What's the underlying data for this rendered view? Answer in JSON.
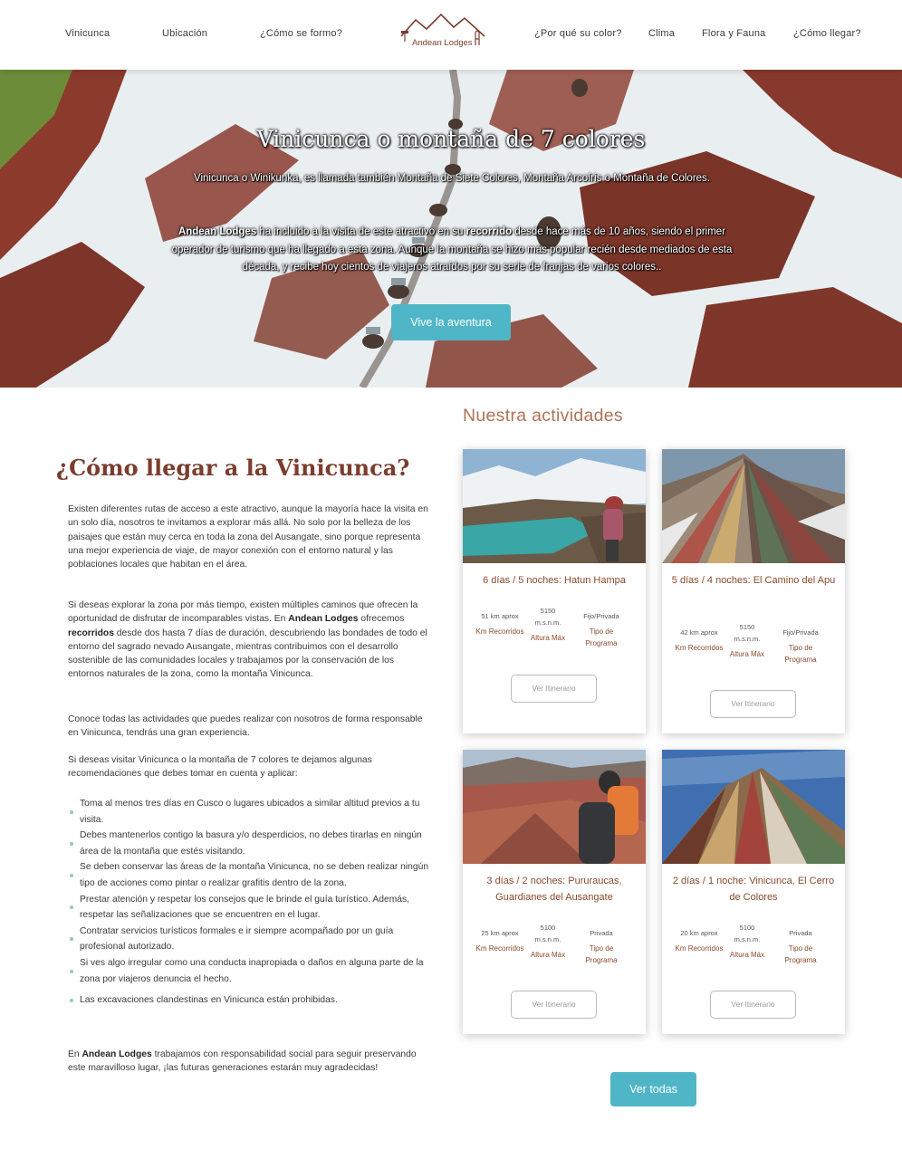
{
  "nav": {
    "left_items": [
      "Vinicunca",
      "Ubicación",
      "¿Cómo se formo?"
    ],
    "right_items": [
      "¿Por qué su color?",
      "Clima",
      "Flora y Fauna",
      "¿Cómo llegar?"
    ],
    "logo_text": "Andean Lodges"
  },
  "hero": {
    "title": "Vinicunca o montaña de 7 colores",
    "intro": "Vinicunca o Winikunka, es llamada también Montaña de Siete Colores, Montaña Arcoíris o Montaña de Colores.",
    "p2_brand": "Andean Lodges",
    "p2_a": " ha incluido a la visita de este atractivo en su ",
    "p2_bold": "recorrido",
    "p2_b": " desde hace más de 10 años, siendo el primer operador de turismo que ha llegado a esta zona. Aunque la montaña se hizo más popular recién desde mediados de esta década, y recibe hoy cientos de viajeros atraídos por su serie de franjas de varios colores..",
    "button": "Vive la aventura"
  },
  "howto": {
    "title": "¿Cómo llegar a la Vinicunca?",
    "p1": "Existen diferentes rutas de acceso a este atractivo, aunque la mayoría hace la visita en un solo día, nosotros te invitamos a explorar más allá. No solo por la belleza de los paisajes que están muy cerca en toda la zona del Ausangate, sino porque representa una mejor experiencia de viaje, de mayor conexión con el entorno natural y las poblaciones locales que habitan en el área.",
    "p2_a": "Si deseas explorar la zona por más tiempo, existen múltiples caminos que ofrecen la oportunidad de disfrutar de incomparables vistas. En ",
    "p2_brand": "Andean Lodges",
    "p2_b": " ofrecemos ",
    "p2_bold": "recorridos",
    "p2_c": " desde dos hasta 7 días de duración, descubriendo las bondades de todo el entorno del sagrado nevado Ausangate, mientras contribuimos con el desarrollo sostenible de las comunidades locales y trabajamos por la conservación de los entornos naturales de la zona, como la montaña Vinicunca.",
    "p3": "Conoce todas las actividades que puedes realizar con nosotros de forma responsable en Vinicunca, tendrás una gran experiencia.",
    "p4": "Si deseas visitar Vinicunca o la montaña de 7 colores te dejamos algunas recomendaciones que debes tomar en cuenta y aplicar:",
    "recommendations": [
      "Toma al menos tres días en Cusco o lugares ubicados a similar altitud previos a tu visita.",
      "Debes mantenerlos contigo la basura y/o desperdicios, no debes tirarlas en ningún área de la montaña que estés visitando.",
      "Se deben conservar las áreas de la montaña Vinicunca, no se deben realizar ningún tipo de acciones como pintar o realizar grafitis dentro de la zona.",
      "Prestar atención y respetar los consejos que le brinde el guía turístico. Además, respetar las señalizaciones que se encuentren en el lugar.",
      "Contratar servicios turísticos formales e ir siempre acompañado por un guía profesional autorizado.",
      "Si ves algo irregular como una conducta inapropiada o daños en alguna parte de la zona por viajeros denuncia el hecho.",
      "Las excavaciones clandestinas en Vinicunca están prohibidas."
    ],
    "closing_a": "En ",
    "closing_brand": "Andean Lodges",
    "closing_b": " trabajamos con responsabilidad social para seguir preservando este maravilloso lugar, ¡las futuras generaciones estarán muy agradecidas!"
  },
  "activities": {
    "title": "Nuestra actividades",
    "see_all": "Ver todas",
    "cards": [
      {
        "title": "6 días / 5 noches: Hatun Hampa",
        "km": "51",
        "km_unit": " km aprox",
        "km_label": "Km Recorridos",
        "alt": "5150",
        "alt_unit": "m.s.n.m.",
        "alt_label": "Altura Máx",
        "type": "Fijo/Privada",
        "type_label": "Tipo de Programa",
        "button": "Ver Itinerario"
      },
      {
        "title": "5 días / 4 noches: El Camino del Apu",
        "km": "42",
        "km_unit": " km aprox",
        "km_label": "Km Recorridos",
        "alt": "5150",
        "alt_unit": "m.s.n.m.",
        "alt_label": "Altura Máx",
        "type": "Fijo/Privada",
        "type_label": "Tipo de Programa",
        "button": "Ver Itinerario"
      },
      {
        "title": "3 días / 2 noches: Pururaucas, Guardianes del Ausangate",
        "km": "25",
        "km_unit": " km aprox",
        "km_label": "Km Recorridos",
        "alt": "5100",
        "alt_unit": "m.s.n.m.",
        "alt_label": "Altura Máx",
        "type": "Privada",
        "type_label": "Tipo de Programa",
        "button": "Ver Itinerario"
      },
      {
        "title": "2 días / 1 noche: Vinicunca, El Cerro de Colores",
        "km": "20",
        "km_unit": " km aprox",
        "km_label": "Km Recorridos",
        "alt": "5100",
        "alt_unit": "m.s.n.m.",
        "alt_label": "Altura Máx",
        "type": "Privada",
        "type_label": "Tipo de Programa",
        "button": "Ver Itinerario"
      }
    ]
  },
  "colors": {
    "accent": "#4fb6c7",
    "brand_brown": "#7a3d2e",
    "title_tan": "#b07258"
  }
}
